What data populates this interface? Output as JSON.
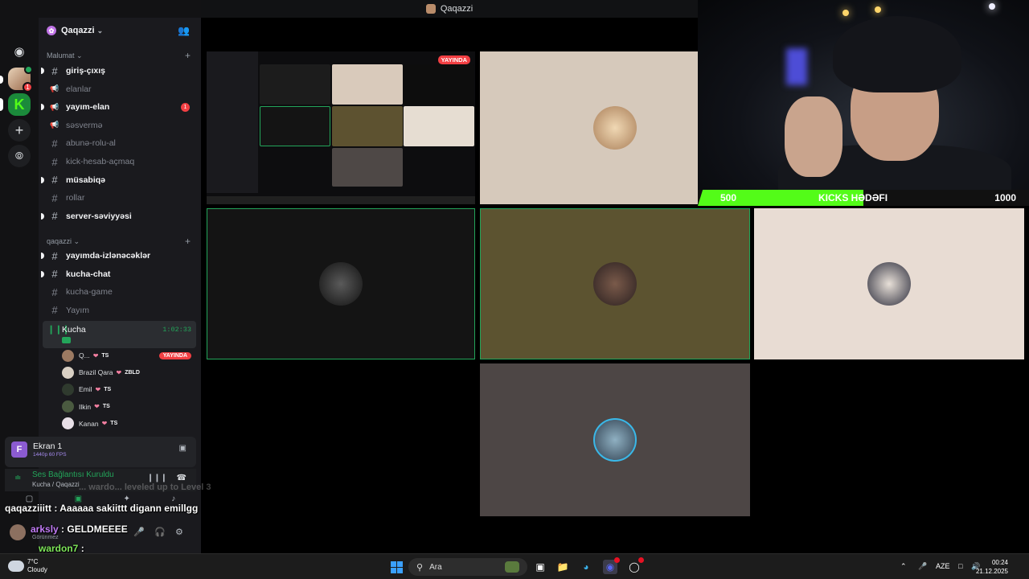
{
  "window": {
    "title": "Qaqazzi"
  },
  "server": {
    "name": "Qaqazzi",
    "rail_badge": "1"
  },
  "categories": [
    {
      "name": "Malumat"
    },
    {
      "name": "qaqazzi"
    }
  ],
  "channels_malumat": [
    {
      "name": "giriş-çıxış",
      "unread": true,
      "icon": "hash-icon"
    },
    {
      "name": "elanlar",
      "unread": false,
      "icon": "megaphone-icon"
    },
    {
      "name": "yayım-elan",
      "unread": true,
      "icon": "megaphone-icon",
      "mentions": "1"
    },
    {
      "name": "səsvermə",
      "unread": false,
      "icon": "megaphone-icon"
    },
    {
      "name": "abunə-rolu-al",
      "unread": false,
      "icon": "hash-icon"
    },
    {
      "name": "kick-hesab-açmaq",
      "unread": false,
      "icon": "hash-icon"
    },
    {
      "name": "müsabiqə",
      "unread": true,
      "icon": "hash-icon"
    },
    {
      "name": "rollar",
      "unread": false,
      "icon": "hash-icon"
    },
    {
      "name": "server-səviyyəsi",
      "unread": true,
      "icon": "hash-icon"
    }
  ],
  "channels_qaqazzi": [
    {
      "name": "yayımda-izlənəcəklər",
      "unread": true,
      "icon": "hash-icon"
    },
    {
      "name": "kucha-chat",
      "unread": true,
      "icon": "hash-icon"
    },
    {
      "name": "kucha-game",
      "unread": false,
      "icon": "hash-icon"
    },
    {
      "name": "Yayım",
      "unread": false,
      "icon": "hash-icon"
    }
  ],
  "voice_channel": {
    "name": "Kucha",
    "elapsed": "1:02:33",
    "users": [
      {
        "name": "Q...",
        "tag": "TS",
        "live": "YAYINDA"
      },
      {
        "name": "Brazil Qara",
        "tag": "ZBLD"
      },
      {
        "name": "Emil",
        "tag": "TS"
      },
      {
        "name": "Ilkin",
        "tag": "TS"
      },
      {
        "name": "Kanan",
        "tag": "TS"
      }
    ]
  },
  "stream_panel": {
    "initial": "F",
    "name": "Ekran 1",
    "quality": "1440p 60 FPS"
  },
  "connection": {
    "status": "Ses Bağlantısı Kuruldu",
    "location": "Kucha / Qaqazzi"
  },
  "user_panel": {
    "status": "Görünmez"
  },
  "screen_share": {
    "live_badge": "YAYINDA"
  },
  "kicks_goal": {
    "current": "500",
    "title": "KICKS HƏDƏFI",
    "target": "1000",
    "progress_fraction": 0.5,
    "fill_color": "#53fc18"
  },
  "chat": {
    "levelup": "... wardo... leveled up to Level 3",
    "messages": [
      {
        "user": "qaqazziiitt",
        "text": ": Aaaaaa sakiittt digann emillgg",
        "color": "white"
      },
      {
        "user": "arksly",
        "text": ": GELDMEEEE",
        "color": "purple"
      },
      {
        "user": "wardon7",
        "text": ":",
        "color": "green"
      }
    ]
  },
  "taskbar": {
    "weather_temp": "7°C",
    "weather_desc": "Cloudy",
    "search_placeholder": "Ara",
    "language": "AZE",
    "time": "00:24",
    "date": "21.12.2025"
  },
  "colors": {
    "accent_green": "#23a55a",
    "live_red": "#f23f43",
    "kick_green": "#53fc18"
  }
}
